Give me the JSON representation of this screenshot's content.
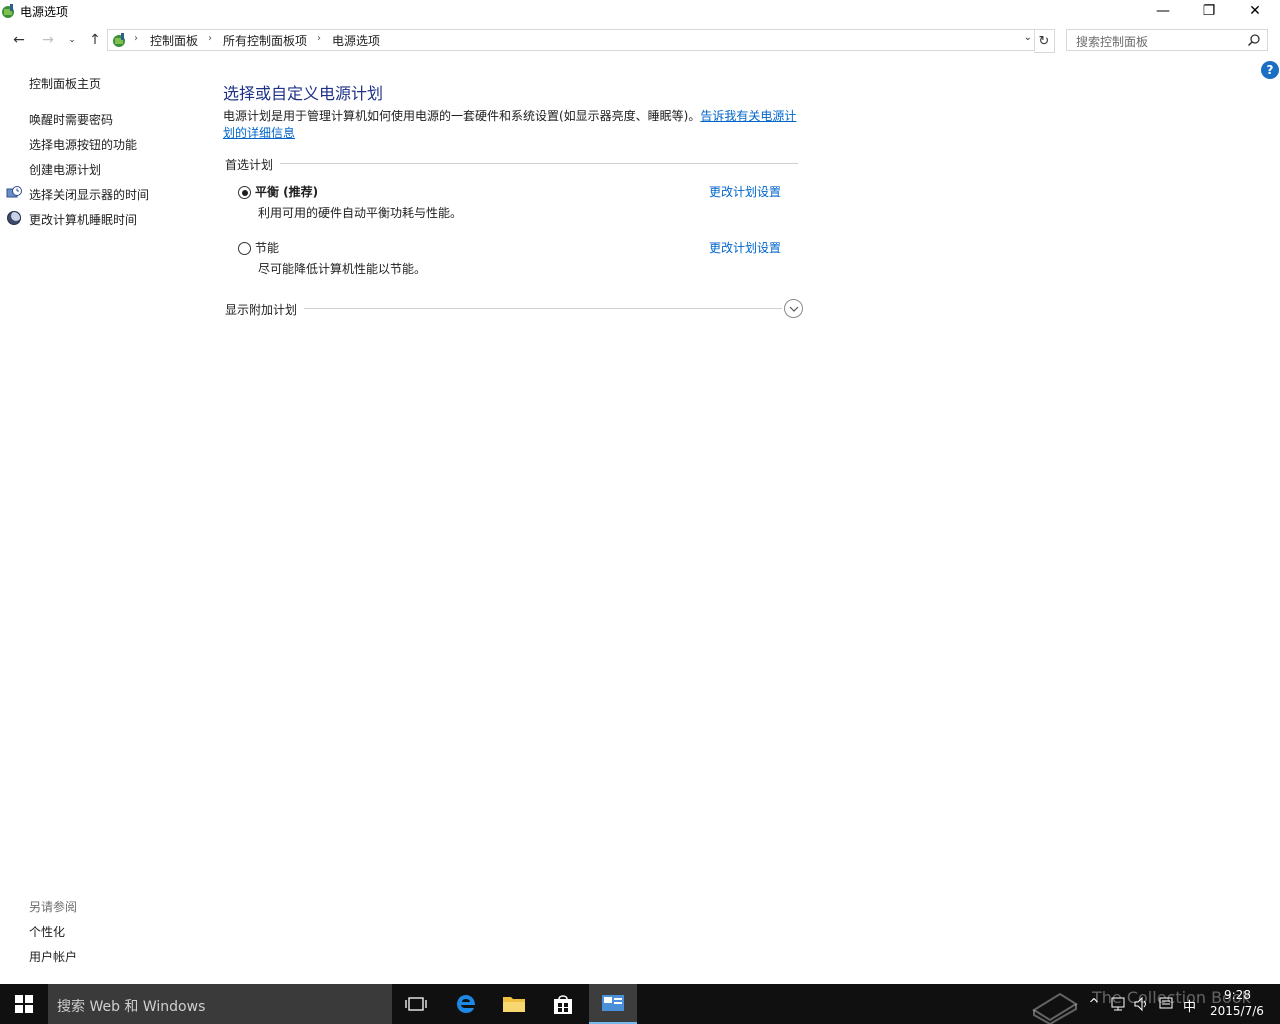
{
  "window": {
    "title": "电源选项",
    "controls": {
      "minimize": "—",
      "maximize": "❐",
      "close": "✕"
    }
  },
  "nav": {
    "back": "←",
    "forward": "→",
    "recent": "⌄",
    "up": "↑",
    "breadcrumb": [
      "控制面板",
      "所有控制面板项",
      "电源选项"
    ],
    "separator": "›",
    "dropdown": "⌄",
    "refresh": "↻",
    "search_placeholder": "搜索控制面板"
  },
  "help": "?",
  "sidebar": {
    "home": "控制面板主页",
    "links": [
      "唤醒时需要密码",
      "选择电源按钮的功能",
      "创建电源计划",
      "选择关闭显示器的时间",
      "更改计算机睡眠时间"
    ],
    "see_also_label": "另请参阅",
    "see_also": [
      "个性化",
      "用户帐户"
    ]
  },
  "main": {
    "title": "选择或自定义电源计划",
    "description": "电源计划是用于管理计算机如何使用电源的一套硬件和系统设置(如显示器亮度、睡眠等)。",
    "description_link": "告诉我有关电源计划的详细信息",
    "preferred_label": "首选计划",
    "plans": [
      {
        "name": "平衡 (推荐)",
        "desc": "利用可用的硬件自动平衡功耗与性能。",
        "link": "更改计划设置",
        "selected": true
      },
      {
        "name": "节能",
        "desc": "尽可能降低计算机性能以节能。",
        "link": "更改计划设置",
        "selected": false
      }
    ],
    "additional_label": "显示附加计划"
  },
  "taskbar": {
    "search_text": "搜索 Web 和 Windows",
    "clock_time": "9:28",
    "clock_date": "2015/7/6",
    "ime": "中",
    "watermark": "The Collection Book"
  }
}
